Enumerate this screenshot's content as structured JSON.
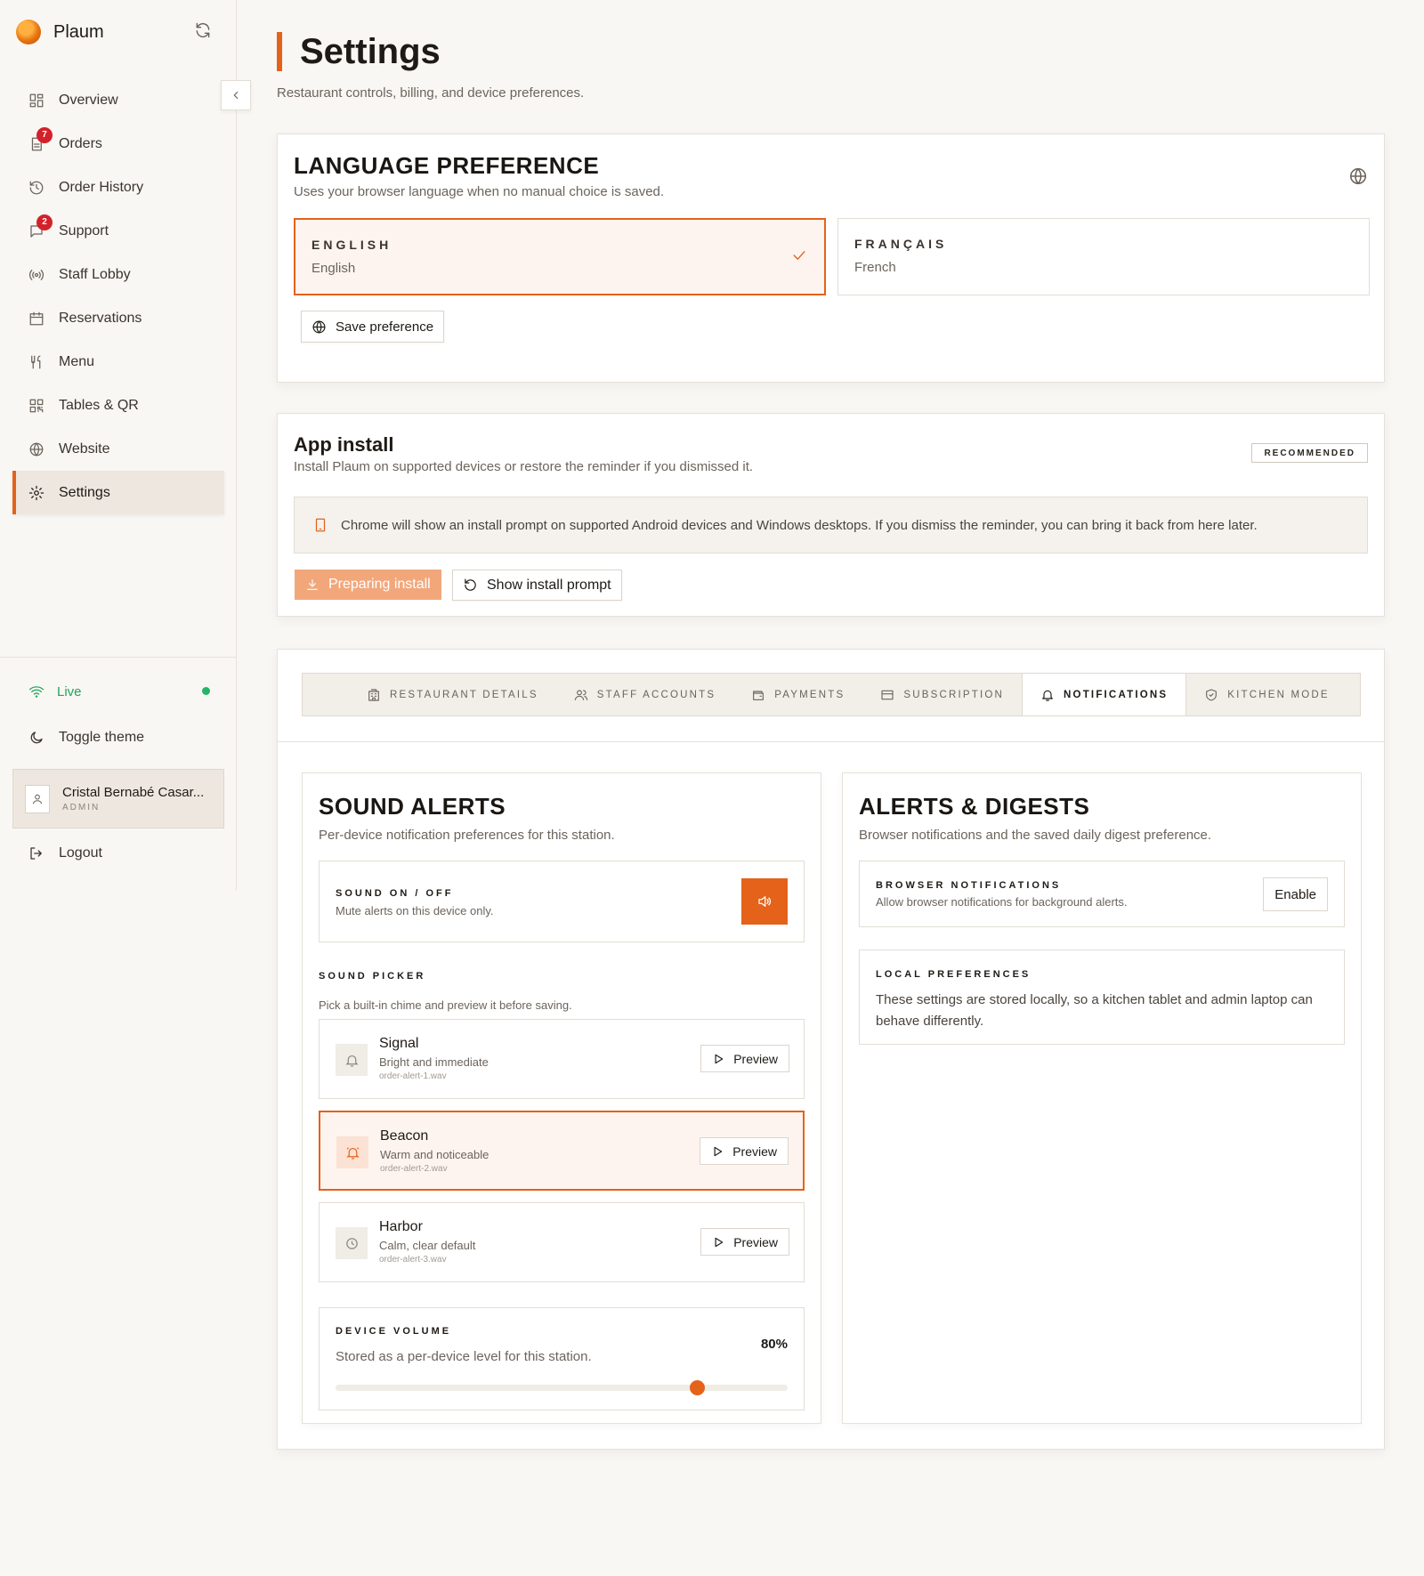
{
  "app": {
    "name": "Plaum"
  },
  "sidebar": {
    "items": [
      {
        "label": "Overview",
        "icon": "grid-icon"
      },
      {
        "label": "Orders",
        "icon": "orders-icon",
        "badge": "7"
      },
      {
        "label": "Order History",
        "icon": "history-icon"
      },
      {
        "label": "Support",
        "icon": "chat-icon",
        "badge": "2"
      },
      {
        "label": "Staff Lobby",
        "icon": "broadcast-icon"
      },
      {
        "label": "Reservations",
        "icon": "calendar-icon"
      },
      {
        "label": "Menu",
        "icon": "utensils-icon"
      },
      {
        "label": "Tables & QR",
        "icon": "qr-icon"
      },
      {
        "label": "Website",
        "icon": "globe-icon"
      },
      {
        "label": "Settings",
        "icon": "gear-icon",
        "active": true
      }
    ],
    "live_label": "Live",
    "toggle_theme": "Toggle theme",
    "user": {
      "name": "Cristal Bernabé Casar...",
      "role": "ADMIN"
    },
    "logout": "Logout"
  },
  "page": {
    "title": "Settings",
    "subtitle": "Restaurant controls, billing, and device preferences."
  },
  "language": {
    "title": "LANGUAGE PREFERENCE",
    "subtitle": "Uses your browser language when no manual choice is saved.",
    "options": [
      {
        "code": "ENGLISH",
        "name": "English",
        "selected": true
      },
      {
        "code": "FRANÇAIS",
        "name": "French",
        "selected": false
      }
    ],
    "save_label": "Save preference"
  },
  "app_install": {
    "title": "App install",
    "subtitle": "Install Plaum on supported devices or restore the reminder if you dismissed it.",
    "badge": "RECOMMENDED",
    "note": "Chrome will show an install prompt on supported Android devices and Windows desktops. If you dismiss the reminder, you can bring it back from here later.",
    "preparing_label": "Preparing install",
    "show_prompt_label": "Show install prompt"
  },
  "tabs": [
    {
      "label": "RESTAURANT DETAILS",
      "icon": "building-icon"
    },
    {
      "label": "STAFF ACCOUNTS",
      "icon": "users-icon"
    },
    {
      "label": "PAYMENTS",
      "icon": "wallet-icon"
    },
    {
      "label": "SUBSCRIPTION",
      "icon": "card-icon"
    },
    {
      "label": "NOTIFICATIONS",
      "icon": "bell-icon",
      "active": true
    },
    {
      "label": "KITCHEN MODE",
      "icon": "shield-icon"
    }
  ],
  "sound_alerts": {
    "title": "SOUND ALERTS",
    "subtitle": "Per-device notification preferences for this station.",
    "toggle_label": "SOUND ON / OFF",
    "toggle_desc": "Mute alerts on this device only.",
    "picker_label": "SOUND PICKER",
    "picker_desc": "Pick a built-in chime and preview it before saving.",
    "sounds": [
      {
        "name": "Signal",
        "desc": "Bright and immediate",
        "file": "order-alert-1.wav",
        "selected": false,
        "icon": "bell-icon"
      },
      {
        "name": "Beacon",
        "desc": "Warm and noticeable",
        "file": "order-alert-2.wav",
        "selected": true,
        "icon": "bell-ring-icon"
      },
      {
        "name": "Harbor",
        "desc": "Calm, clear default",
        "file": "order-alert-3.wav",
        "selected": false,
        "icon": "clock-icon"
      }
    ],
    "preview_label": "Preview",
    "volume_label": "DEVICE VOLUME",
    "volume_desc": "Stored as a per-device level for this station.",
    "volume_text": "80%",
    "volume_value": 0.8
  },
  "alerts_digests": {
    "title": "ALERTS & DIGESTS",
    "subtitle": "Browser notifications and the saved daily digest preference.",
    "browser_label": "BROWSER NOTIFICATIONS",
    "browser_desc": "Allow browser notifications for background alerts.",
    "enable_label": "Enable",
    "local_label": "LOCAL PREFERENCES",
    "local_desc": "These settings are stored locally, so a kitchen tablet and admin laptop can behave differently."
  },
  "colors": {
    "accent": "#e4621a",
    "live": "#21a35b",
    "badge": "#d3212b"
  }
}
